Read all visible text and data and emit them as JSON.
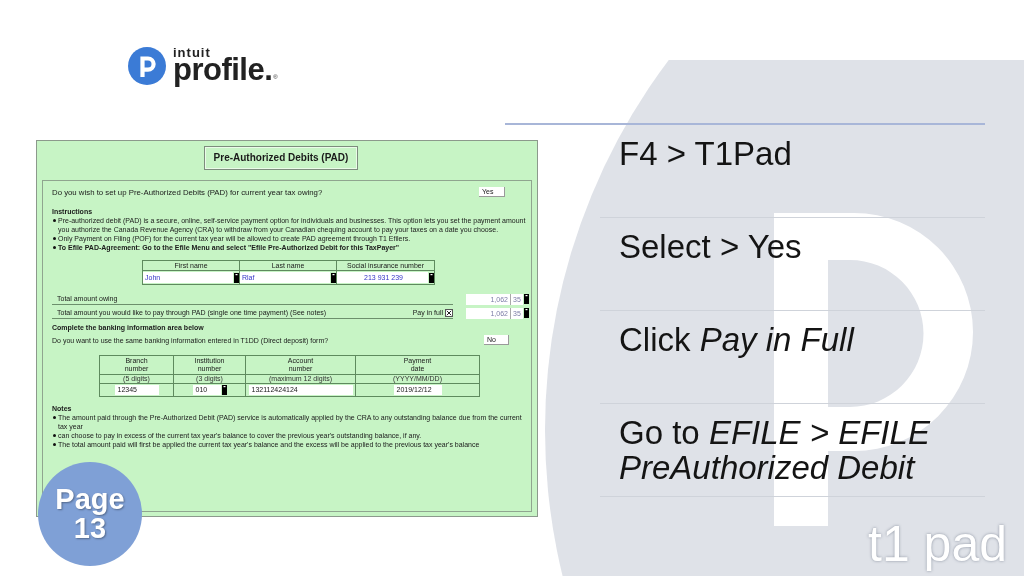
{
  "logo": {
    "company": "intuit",
    "product": "profile.",
    "mark": "®"
  },
  "form": {
    "title": "Pre-Authorized Debits (PAD)",
    "setup_question": {
      "label": "Do you wish to set up Pre-Authorized Debits (PAD) for current year tax owing?",
      "value": "Yes"
    },
    "instructions": {
      "heading": "Instructions",
      "items": [
        {
          "kind": "plain",
          "text": "Pre-authorized debit (PAD) is a secure, online, self-service payment option for individuals and businesses. This option lets you set the payment amount you authorize the Canada Revenue Agency (CRA) to withdraw from your Canadian chequing account to pay your taxes on a date you choose."
        },
        {
          "kind": "plain",
          "text": "Only Payment on Filing (POF) for the current tax year will be allowed to create PAD agreement through T1 Efilers."
        },
        {
          "kind": "bold",
          "text": "To Efile PAD-Agreement: Go to the Efile Menu and select \"Efile Pre-Authorized Debit for this TaxPayer\""
        }
      ]
    },
    "taxpayer_table": {
      "columns": [
        {
          "title": "First name",
          "value": "John"
        },
        {
          "title": "Last name",
          "value": "Rlaf"
        },
        {
          "title": "Social insurance number",
          "value": "213 931 239"
        }
      ]
    },
    "amounts": [
      {
        "label": "Total amount owing",
        "dollars": "1,062",
        "cents": "35"
      },
      {
        "label": "Total amount you would like to pay through PAD (single one time payment) (See notes)",
        "option": {
          "label": "Pay in full",
          "checked": true
        },
        "dollars": "1,062",
        "cents": "35"
      }
    ],
    "banking_heading": "Complete the banking information area below",
    "same_banking_question": {
      "label": "Do you want to use the same banking information entered in T1DD (Direct deposit) form?",
      "value": "No"
    },
    "banking_table": {
      "columns": [
        {
          "title": "Branch\nnumber",
          "hint": "(5 digits)",
          "value": "12345",
          "tab": false
        },
        {
          "title": "Institution\nnumber",
          "hint": "(3 digits)",
          "value": "010",
          "tab": true
        },
        {
          "title": "Account\nnumber",
          "hint": "(maximum 12 digits)",
          "value": "132112424124",
          "tab": false
        },
        {
          "title": "Payment\ndate",
          "hint": "(YYYY/MM/DD)",
          "value": "2019/12/12",
          "tab": false
        }
      ]
    },
    "notes": {
      "heading": "Notes",
      "items": [
        "The amount paid through the Pre-Authorized Debit (PAD) service is automatically applied by the CRA to any outstanding balance due from the current tax year",
        "can choose to pay in excess of the current tax year's balance to cover the previous year's outstanding balance, if any.",
        "The total amount paid will first be applied the current tax year's balance and the excess will be applied to the previous tax year's balance"
      ]
    }
  },
  "page_badge": "Page 13",
  "steps": [
    {
      "text": "F4 > T1Pad"
    },
    {
      "text": "Select > Yes"
    },
    {
      "text": "Click *Pay in Full*"
    },
    {
      "text": "Go to *EFILE > EFILE PreAuthorized Debit*"
    }
  ],
  "background_caption": "t1 pad"
}
